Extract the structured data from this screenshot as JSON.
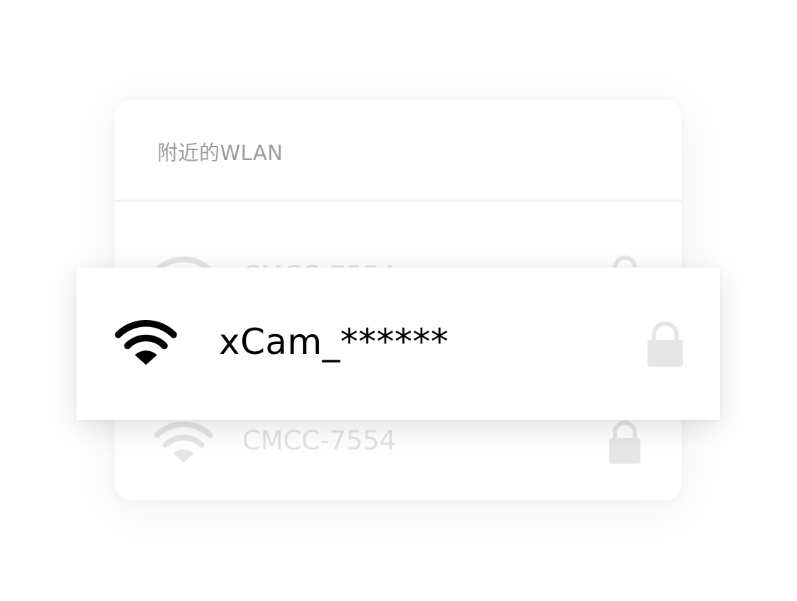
{
  "list": {
    "title": "附近的WLAN",
    "rows": [
      {
        "ssid": "CMCC-7554",
        "icon": "wifi-icon",
        "secure_icon": "lock-icon"
      },
      {
        "ssid": "CMCC-7554",
        "icon": "wifi-icon",
        "secure_icon": "lock-icon"
      }
    ]
  },
  "selected": {
    "ssid": "xCam_******",
    "icon": "wifi-icon",
    "secure_icon": "lock-icon"
  },
  "colors": {
    "title_text": "#9c9c9c",
    "dim_text": "#e3e3e3",
    "dim_icon": "#e6e6e6",
    "active_text": "#000000",
    "lock_icon": "#e6e6e6",
    "divider": "#f1f1f1"
  }
}
